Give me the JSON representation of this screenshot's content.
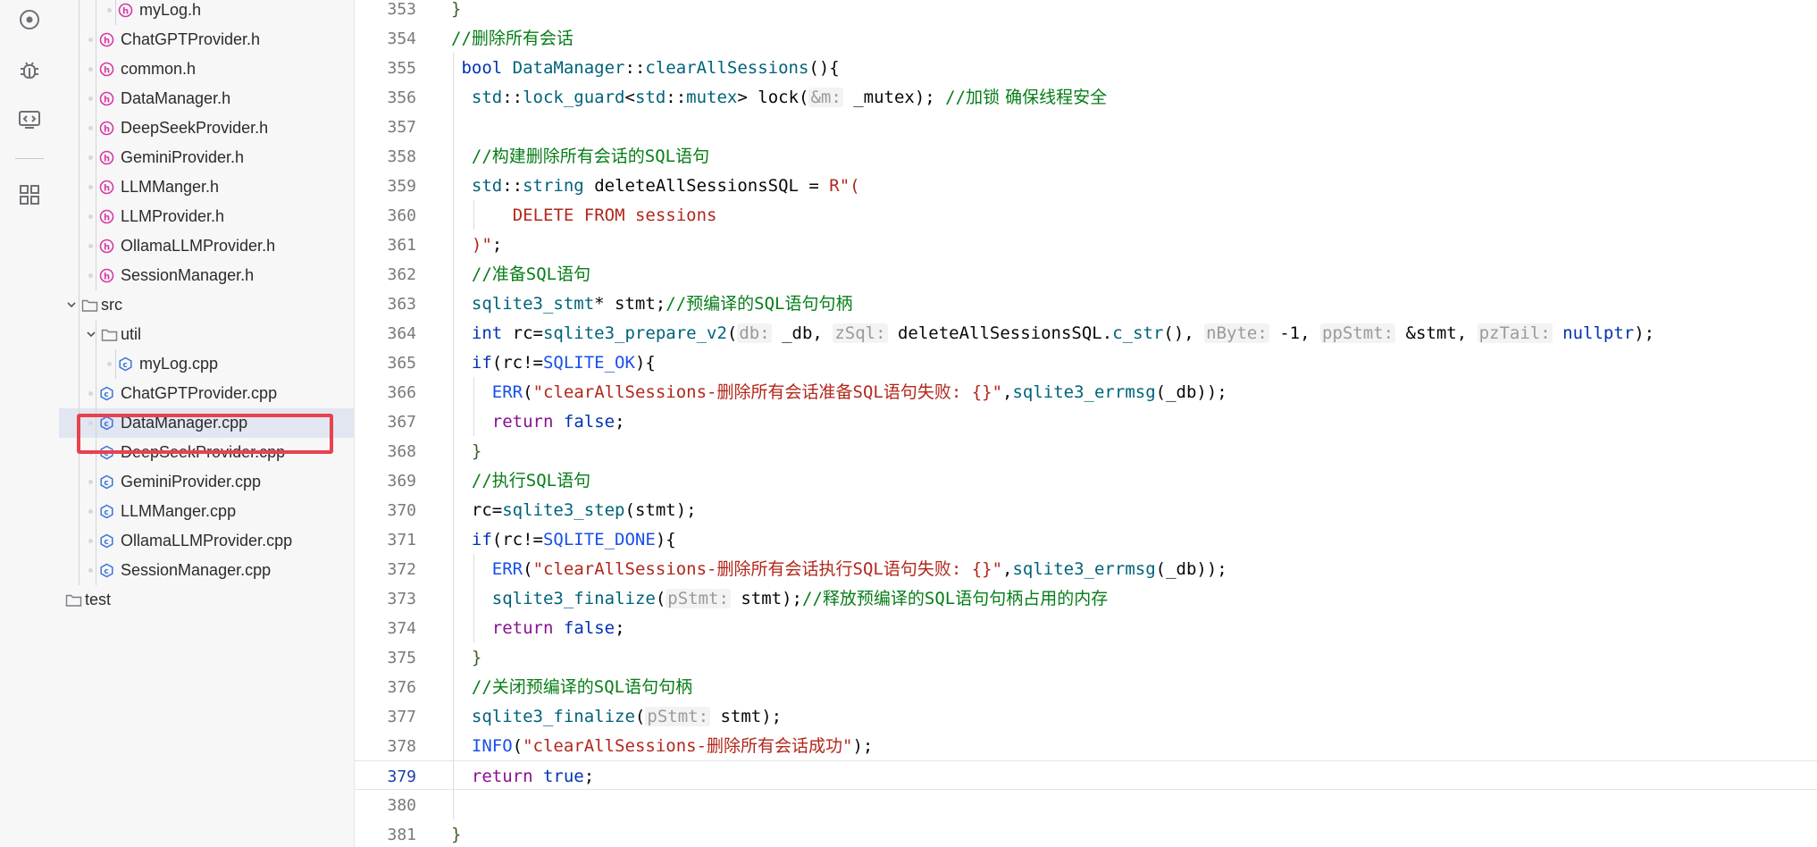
{
  "activity_bar": {
    "icons": [
      "eye-icon",
      "bug-icon",
      "monitor-code-icon",
      "grid-icon"
    ]
  },
  "sidebar": {
    "tree": [
      {
        "name": "myLog.h",
        "kind": "header",
        "depth": 3
      },
      {
        "name": "ChatGPTProvider.h",
        "kind": "header",
        "depth": 2
      },
      {
        "name": "common.h",
        "kind": "header",
        "depth": 2
      },
      {
        "name": "DataManager.h",
        "kind": "header",
        "depth": 2
      },
      {
        "name": "DeepSeekProvider.h",
        "kind": "header",
        "depth": 2
      },
      {
        "name": "GeminiProvider.h",
        "kind": "header",
        "depth": 2
      },
      {
        "name": "LLMManger.h",
        "kind": "header",
        "depth": 2
      },
      {
        "name": "LLMProvider.h",
        "kind": "header",
        "depth": 2
      },
      {
        "name": "OllamaLLMProvider.h",
        "kind": "header",
        "depth": 2
      },
      {
        "name": "SessionManager.h",
        "kind": "header",
        "depth": 2
      },
      {
        "name": "src",
        "kind": "folder-open",
        "depth": 1
      },
      {
        "name": "util",
        "kind": "folder-open",
        "depth": 2
      },
      {
        "name": "myLog.cpp",
        "kind": "cpp",
        "depth": 3
      },
      {
        "name": "ChatGPTProvider.cpp",
        "kind": "cpp",
        "depth": 2
      },
      {
        "name": "DataManager.cpp",
        "kind": "cpp",
        "depth": 2,
        "selected": true
      },
      {
        "name": "DeepSeekProvider.cpp",
        "kind": "cpp",
        "depth": 2
      },
      {
        "name": "GeminiProvider.cpp",
        "kind": "cpp",
        "depth": 2
      },
      {
        "name": "LLMManger.cpp",
        "kind": "cpp",
        "depth": 2
      },
      {
        "name": "OllamaLLMProvider.cpp",
        "kind": "cpp",
        "depth": 2
      },
      {
        "name": "SessionManager.cpp",
        "kind": "cpp",
        "depth": 2
      },
      {
        "name": "test",
        "kind": "folder-closed",
        "depth": 0
      }
    ]
  },
  "editor": {
    "current_line": 379,
    "lines": [
      {
        "n": 353,
        "indent": 0,
        "tokens": [
          [
            "brace",
            "}"
          ]
        ]
      },
      {
        "n": 354,
        "indent": 0,
        "tokens": [
          [
            "cm",
            "//"
          ],
          [
            "cmz",
            "删除所有会话"
          ]
        ]
      },
      {
        "n": 355,
        "indent": 1,
        "tokens": [
          [
            "kw",
            "bool "
          ],
          [
            "ns",
            "DataManager"
          ],
          [
            "",
            "::"
          ],
          [
            "fn",
            "clearAllSessions"
          ],
          [
            "",
            "(){"
          ]
        ]
      },
      {
        "n": 356,
        "indent": 2,
        "tokens": [
          [
            "ns",
            "std"
          ],
          [
            "",
            "::"
          ],
          [
            "fn",
            "lock_guard"
          ],
          [
            "",
            "<"
          ],
          [
            "ns",
            "std"
          ],
          [
            "",
            "::"
          ],
          [
            "fn",
            "mutex"
          ],
          [
            "",
            "> lock("
          ],
          [
            "hint",
            "&m:"
          ],
          [
            "",
            " _mutex); "
          ],
          [
            "cm",
            "//"
          ],
          [
            "cmz",
            "加锁 确保线程安全"
          ]
        ]
      },
      {
        "n": 357,
        "indent": 2,
        "tokens": []
      },
      {
        "n": 358,
        "indent": 2,
        "tokens": [
          [
            "cm",
            "//"
          ],
          [
            "cmz",
            "构建删除所有会话的"
          ],
          [
            "cm",
            "SQL"
          ],
          [
            "cmz",
            "语句"
          ]
        ]
      },
      {
        "n": 359,
        "indent": 2,
        "tokens": [
          [
            "ns",
            "std"
          ],
          [
            "",
            "::"
          ],
          [
            "fn",
            "string"
          ],
          [
            "",
            " deleteAllSessionsSQL = "
          ],
          [
            "str",
            "R\"("
          ]
        ]
      },
      {
        "n": 360,
        "indent": 6,
        "tokens": [
          [
            "str",
            "DELETE FROM sessions"
          ]
        ]
      },
      {
        "n": 361,
        "indent": 2,
        "tokens": [
          [
            "str",
            ")\""
          ],
          [
            "",
            ";"
          ]
        ]
      },
      {
        "n": 362,
        "indent": 2,
        "tokens": [
          [
            "cm",
            "//"
          ],
          [
            "cmz",
            "准备"
          ],
          [
            "cm",
            "SQL"
          ],
          [
            "cmz",
            "语句"
          ]
        ]
      },
      {
        "n": 363,
        "indent": 2,
        "tokens": [
          [
            "fn",
            "sqlite3_stmt"
          ],
          [
            "",
            "* stmt;"
          ],
          [
            "cm",
            "//"
          ],
          [
            "cmz",
            "预编译的"
          ],
          [
            "cm",
            "SQL"
          ],
          [
            "cmz",
            "语句句柄"
          ]
        ]
      },
      {
        "n": 364,
        "indent": 2,
        "tokens": [
          [
            "kw",
            "int "
          ],
          [
            "",
            "rc="
          ],
          [
            "fn",
            "sqlite3_prepare_v2"
          ],
          [
            "",
            "("
          ],
          [
            "hint",
            "db:"
          ],
          [
            "",
            " _db, "
          ],
          [
            "hint",
            "zSql:"
          ],
          [
            "",
            " deleteAllSessionsSQL."
          ],
          [
            "fn",
            "c_str"
          ],
          [
            "",
            "(), "
          ],
          [
            "hint",
            "nByte:"
          ],
          [
            "",
            " -1, "
          ],
          [
            "hint",
            "ppStmt:"
          ],
          [
            "",
            " &stmt, "
          ],
          [
            "hint",
            "pzTail:"
          ],
          [
            "",
            " "
          ],
          [
            "kw",
            "nullptr"
          ],
          [
            "",
            ");"
          ]
        ]
      },
      {
        "n": 365,
        "indent": 2,
        "tokens": [
          [
            "kw",
            "if"
          ],
          [
            "",
            "(rc!="
          ],
          [
            "const",
            "SQLITE_OK"
          ],
          [
            "",
            "){"
          ]
        ]
      },
      {
        "n": 366,
        "indent": 4,
        "tokens": [
          [
            "mac",
            "ERR"
          ],
          [
            "",
            "("
          ],
          [
            "str",
            "\"clearAllSessions-"
          ],
          [
            "str",
            "删除所有会话准备"
          ],
          [
            "str",
            "SQL"
          ],
          [
            "str",
            "语句失败: {}\""
          ],
          [
            "",
            ","
          ],
          [
            "fn",
            "sqlite3_errmsg"
          ],
          [
            "",
            "(_db));"
          ]
        ]
      },
      {
        "n": 367,
        "indent": 4,
        "tokens": [
          [
            "kw2",
            "return "
          ],
          [
            "kw",
            "false"
          ],
          [
            "",
            ";"
          ]
        ]
      },
      {
        "n": 368,
        "indent": 2,
        "tokens": [
          [
            "brace",
            "}"
          ]
        ]
      },
      {
        "n": 369,
        "indent": 2,
        "tokens": [
          [
            "cm",
            "//"
          ],
          [
            "cmz",
            "执行"
          ],
          [
            "cm",
            "SQL"
          ],
          [
            "cmz",
            "语句"
          ]
        ]
      },
      {
        "n": 370,
        "indent": 2,
        "tokens": [
          [
            "",
            "rc="
          ],
          [
            "fn",
            "sqlite3_step"
          ],
          [
            "",
            "(stmt);"
          ]
        ]
      },
      {
        "n": 371,
        "indent": 2,
        "tokens": [
          [
            "kw",
            "if"
          ],
          [
            "",
            "(rc!="
          ],
          [
            "const",
            "SQLITE_DONE"
          ],
          [
            "",
            "){"
          ]
        ]
      },
      {
        "n": 372,
        "indent": 4,
        "tokens": [
          [
            "mac",
            "ERR"
          ],
          [
            "",
            "("
          ],
          [
            "str",
            "\"clearAllSessions-"
          ],
          [
            "str",
            "删除所有会话执行"
          ],
          [
            "str",
            "SQL"
          ],
          [
            "str",
            "语句失败: {}\""
          ],
          [
            "",
            ","
          ],
          [
            "fn",
            "sqlite3_errmsg"
          ],
          [
            "",
            "(_db));"
          ]
        ]
      },
      {
        "n": 373,
        "indent": 4,
        "tokens": [
          [
            "fn",
            "sqlite3_finalize"
          ],
          [
            "",
            "("
          ],
          [
            "hint",
            "pStmt:"
          ],
          [
            "",
            " stmt);"
          ],
          [
            "cm",
            "//"
          ],
          [
            "cmz",
            "释放预编译的"
          ],
          [
            "cm",
            "SQL"
          ],
          [
            "cmz",
            "语句句柄占用的内存"
          ]
        ]
      },
      {
        "n": 374,
        "indent": 4,
        "tokens": [
          [
            "kw2",
            "return "
          ],
          [
            "kw",
            "false"
          ],
          [
            "",
            ";"
          ]
        ]
      },
      {
        "n": 375,
        "indent": 2,
        "tokens": [
          [
            "brace",
            "}"
          ]
        ]
      },
      {
        "n": 376,
        "indent": 2,
        "tokens": [
          [
            "cm",
            "//"
          ],
          [
            "cmz",
            "关闭预编译的"
          ],
          [
            "cm",
            "SQL"
          ],
          [
            "cmz",
            "语句句柄"
          ]
        ]
      },
      {
        "n": 377,
        "indent": 2,
        "tokens": [
          [
            "fn",
            "sqlite3_finalize"
          ],
          [
            "",
            "("
          ],
          [
            "hint",
            "pStmt:"
          ],
          [
            "",
            " stmt);"
          ]
        ]
      },
      {
        "n": 378,
        "indent": 2,
        "tokens": [
          [
            "mac",
            "INFO"
          ],
          [
            "",
            "("
          ],
          [
            "str",
            "\"clearAllSessions-"
          ],
          [
            "str",
            "删除所有会话成功\""
          ],
          [
            "",
            ");"
          ]
        ]
      },
      {
        "n": 379,
        "indent": 2,
        "tokens": [
          [
            "kw2",
            "return "
          ],
          [
            "kw",
            "true"
          ],
          [
            "",
            ";"
          ]
        ]
      },
      {
        "n": 380,
        "indent": 0,
        "tokens": []
      },
      {
        "n": 381,
        "indent": 0,
        "tokens": [
          [
            "brace",
            "}"
          ]
        ]
      }
    ]
  }
}
